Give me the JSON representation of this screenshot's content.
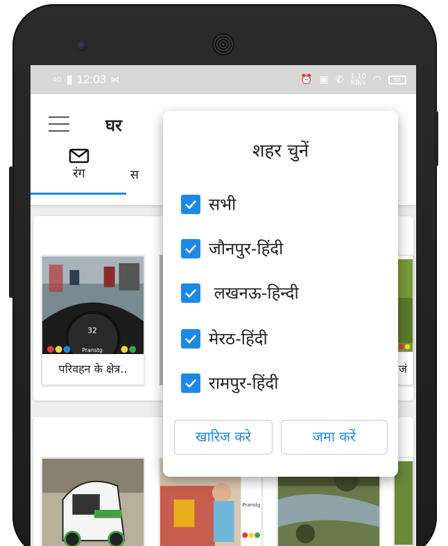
{
  "status_bar": {
    "network": "4G",
    "time": "12:03",
    "speed_top": "1.10",
    "speed_bottom": "KB/s",
    "battery": "58"
  },
  "app_bar": {
    "title": "घर",
    "tabs": [
      {
        "label": "रंग",
        "icon": "mail-icon"
      },
      {
        "label": "स"
      }
    ]
  },
  "cards": {
    "row1": [
      {
        "caption": "परिवहन के क्षेत्र..",
        "logo_text": "Pranstg"
      },
      {
        "caption": ""
      },
      {
        "caption": "जं"
      }
    ],
    "row2": [
      {
        "caption": ""
      },
      {
        "caption": "",
        "logo_text": "Pranstg"
      },
      {
        "caption": ""
      }
    ]
  },
  "dialog": {
    "title": "शहर चुनें",
    "options": [
      {
        "label": "सभी",
        "checked": true
      },
      {
        "label": "जौनपुर-हिंदी",
        "checked": true
      },
      {
        "label": " लखनऊ-हिन्दी",
        "checked": true
      },
      {
        "label": "मेरठ-हिंदी",
        "checked": true
      },
      {
        "label": "रामपुर-हिंदी",
        "checked": true
      }
    ],
    "dismiss_label": "खारिज करे",
    "submit_label": "जमा करें"
  },
  "colors": {
    "accent": "#1e88e5",
    "statusbar": "#d7d7d7",
    "phone_body": "#1c1c1c"
  }
}
